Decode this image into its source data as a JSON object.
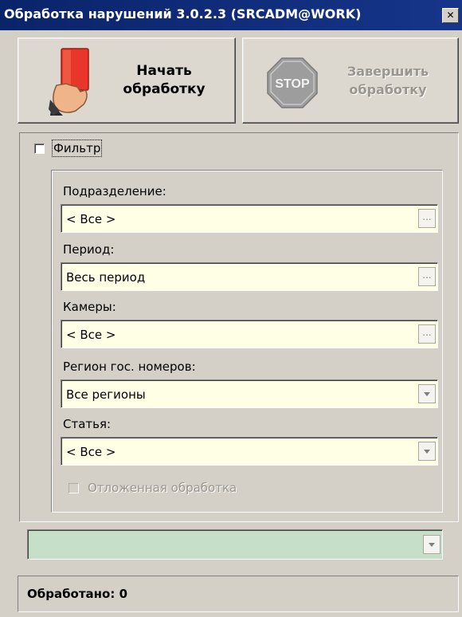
{
  "window": {
    "title": "Обработка нарушений 3.0.2.3 (SRCADM@WORK)"
  },
  "toolbar": {
    "start_line1": "Начать",
    "start_line2": "обработку",
    "stop_icon_text": "STOP",
    "stop_line1": "Завершить",
    "stop_line2": "обработку"
  },
  "filter": {
    "label": "Фильтр",
    "checked": false,
    "department": {
      "label": "Подразделение:",
      "value": "< Все >",
      "button": "..."
    },
    "period": {
      "label": "Период:",
      "value": "Весь период",
      "button": "..."
    },
    "cameras": {
      "label": "Камеры:",
      "value": "< Все >",
      "button": "..."
    },
    "region": {
      "label": "Регион гос. номеров:",
      "value": "Все регионы"
    },
    "article": {
      "label": "Статья:",
      "value": "< Все >"
    },
    "deferred": {
      "label": "Отложенная обработка",
      "checked": false,
      "enabled": false
    }
  },
  "status_combo": {
    "value": ""
  },
  "statusbar": {
    "text": "Обработано: 0"
  },
  "colors": {
    "title_bar": "#0a246a",
    "field_bg": "#ffffe6",
    "status_combo_bg": "#c5dfc9",
    "card_red": "#e8372a",
    "stop_sign": "#9d9d9d"
  },
  "icons": {
    "start": "red-card-hand-icon",
    "stop": "stop-sign-icon"
  }
}
